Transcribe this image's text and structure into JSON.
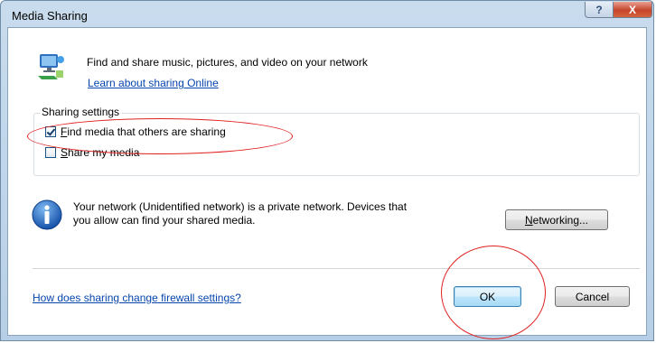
{
  "window": {
    "title": "Media Sharing",
    "help_glyph": "?",
    "close_glyph": "X"
  },
  "header": {
    "headline": "Find and share music, pictures, and video on your network",
    "link": "Learn about sharing Online"
  },
  "sharing_settings": {
    "group_title": "Sharing settings",
    "options": [
      {
        "accel": "F",
        "rest": "ind media that others are sharing",
        "checked": true
      },
      {
        "accel": "S",
        "rest": "hare my media",
        "checked": false
      }
    ]
  },
  "network": {
    "message_line1": "Your network (Unidentified network) is a private network. Devices that",
    "message_line2": "you allow can find your shared media.",
    "button_accel": "N",
    "button_rest": "etworking..."
  },
  "footer": {
    "firewall_link": "How does sharing change firewall settings?",
    "ok_label": "OK",
    "cancel_label": "Cancel"
  },
  "colors": {
    "link": "#0645ad",
    "annotation": "#e02020",
    "title_bar": "#c9dcee"
  },
  "icons": [
    "media-sharing-icon",
    "info-icon",
    "help-icon",
    "close-icon",
    "checkmark-icon"
  ]
}
